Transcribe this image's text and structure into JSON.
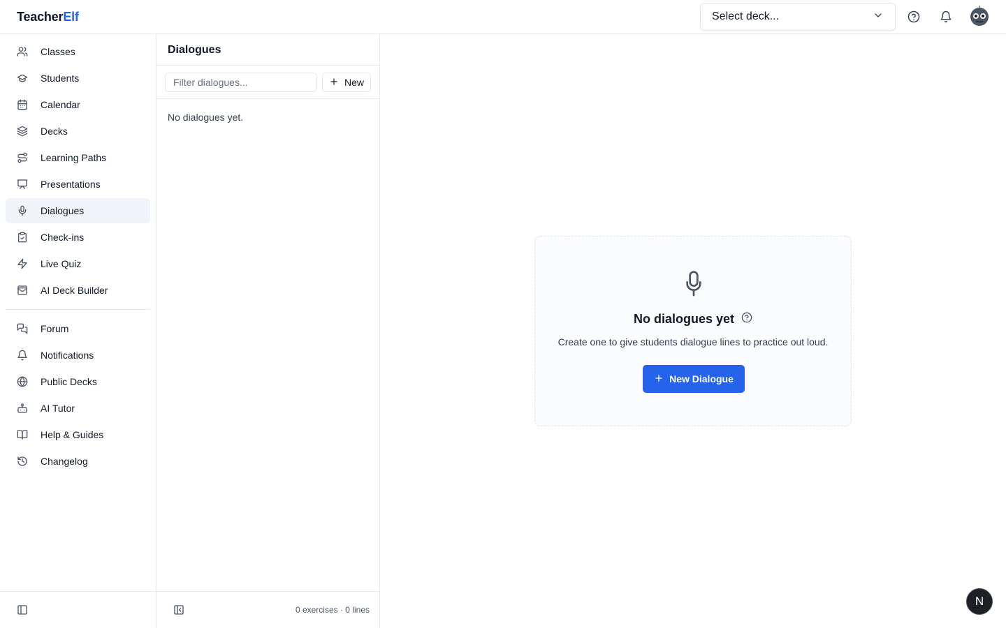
{
  "app": {
    "name_part1": "Teacher",
    "name_part2": "Elf"
  },
  "header": {
    "deck_select": {
      "label": "Select deck..."
    },
    "help_icon": "help-circle-icon",
    "bell_icon": "bell-icon",
    "avatar_icon": "robot-avatar-icon"
  },
  "sidebar": {
    "primary": [
      {
        "label": "Classes",
        "icon": "users-icon"
      },
      {
        "label": "Students",
        "icon": "graduation-cap-icon"
      },
      {
        "label": "Calendar",
        "icon": "calendar-icon"
      },
      {
        "label": "Decks",
        "icon": "layers-icon"
      },
      {
        "label": "Learning Paths",
        "icon": "route-icon"
      },
      {
        "label": "Presentations",
        "icon": "presentation-icon"
      },
      {
        "label": "Dialogues",
        "icon": "mic-icon",
        "active": true
      },
      {
        "label": "Check-ins",
        "icon": "clipboard-check-icon"
      },
      {
        "label": "Live Quiz",
        "icon": "zap-icon"
      },
      {
        "label": "AI Deck Builder",
        "icon": "wallet-cards-icon"
      }
    ],
    "secondary": [
      {
        "label": "Forum",
        "icon": "messages-icon"
      },
      {
        "label": "Notifications",
        "icon": "bell-icon"
      },
      {
        "label": "Public Decks",
        "icon": "globe-icon"
      },
      {
        "label": "AI Tutor",
        "icon": "bot-icon"
      },
      {
        "label": "Help & Guides",
        "icon": "book-open-icon"
      },
      {
        "label": "Changelog",
        "icon": "history-icon"
      }
    ]
  },
  "list_panel": {
    "title": "Dialogues",
    "filter_placeholder": "Filter dialogues...",
    "new_label": "New",
    "empty_text": "No dialogues yet.",
    "stats": "0 exercises · 0 lines"
  },
  "empty_state": {
    "title": "No dialogues yet",
    "subtitle": "Create one to give students dialogue lines to practice out loud.",
    "button_label": "New Dialogue"
  },
  "fab": {
    "label": "N"
  },
  "colors": {
    "accent": "#2563eb",
    "active_bg": "#f1f5f9",
    "border": "#e5e7eb"
  }
}
